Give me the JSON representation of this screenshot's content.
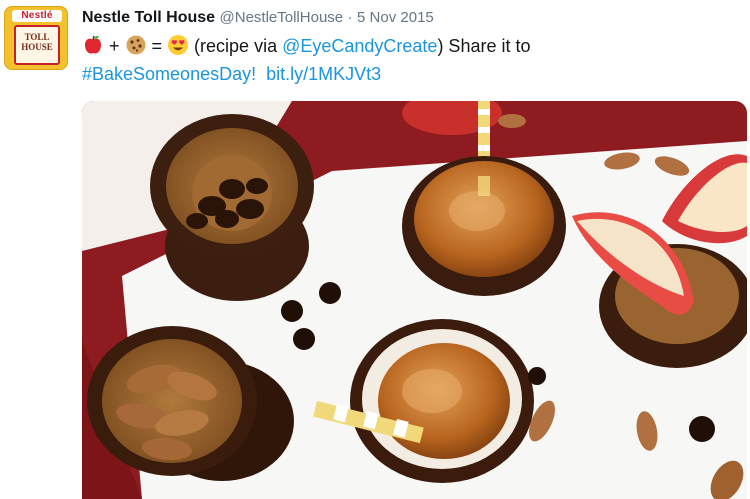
{
  "tweet": {
    "author": {
      "name": "Nestle Toll House",
      "handle": "@NestleTollHouse",
      "separator": "·",
      "date": "5 Nov 2015",
      "avatar_lines": [
        "Nestlé",
        "TOLL",
        "HOUSE"
      ]
    },
    "body": {
      "emojis": [
        "apple-emoji",
        "cookie-emoji",
        "heart-eyes-emoji"
      ],
      "plus": "+",
      "equals": "=",
      "text_open": "(recipe via ",
      "mention": "@EyeCandyCreate",
      "text_close": ") Share it to",
      "hashtag": "#BakeSomeonesDay!",
      "url": "bit.ly/1MKJVt3"
    },
    "media": {
      "type": "photo",
      "subject": "chocolate-dipped cookie cups filled with chocolate chips, caramel, apple slices and almonds"
    },
    "colors": {
      "name": "#14171a",
      "meta": "#657786",
      "link": "#1b95e0",
      "avatar_bg": "#f2c12e",
      "avatar_red": "#c62128"
    }
  }
}
